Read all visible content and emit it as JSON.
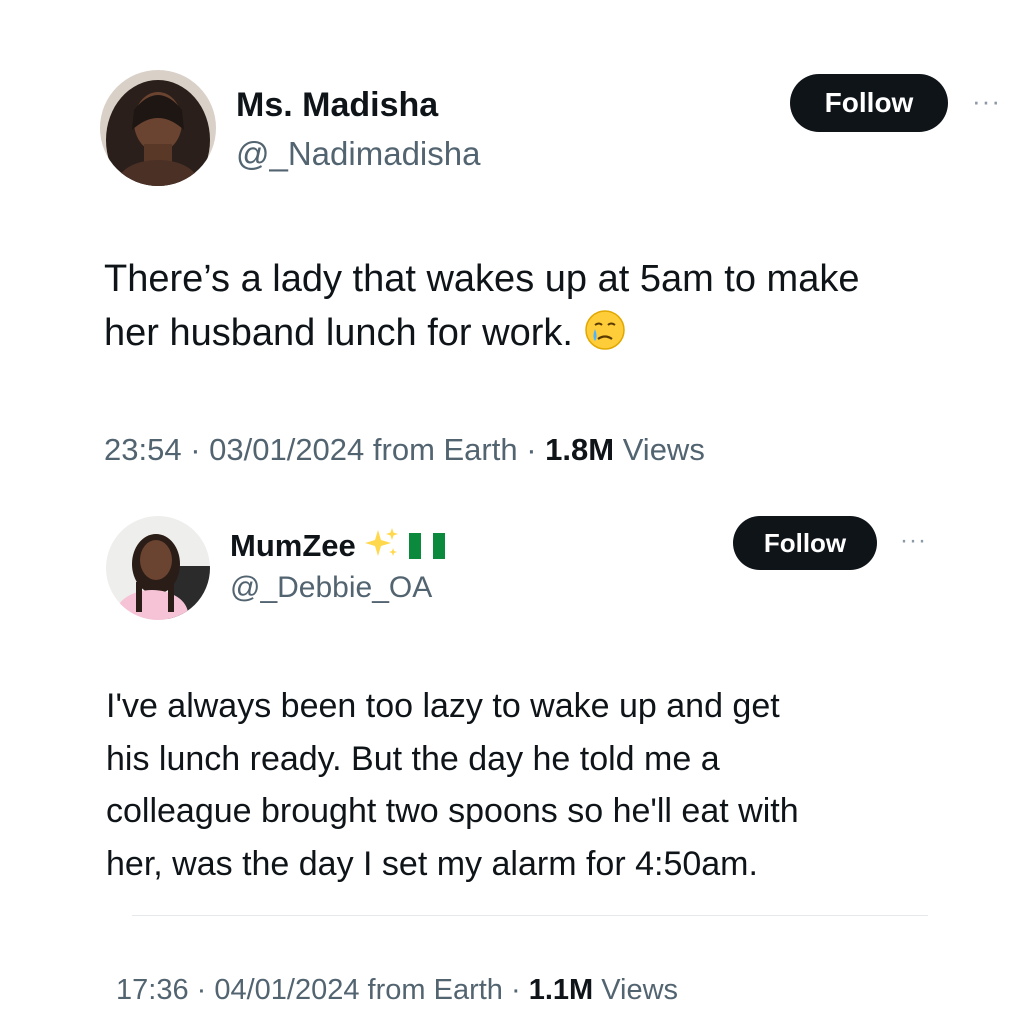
{
  "tweet1": {
    "display_name": "Ms. Madisha",
    "handle": "@_Nadimadisha",
    "follow_label": "Follow",
    "more_label": "···",
    "text_line1": "There’s a lady that wakes up at 5am to make",
    "text_line2": "her husband lunch for work.",
    "emoji": "crying-face-emoji",
    "meta_time": "23:54 · 03/01/2024 from Earth · ",
    "views_count": "1.8M",
    "views_label": " Views"
  },
  "tweet2": {
    "display_name": "MumZee",
    "name_icons": [
      "sparkles-icon",
      "nigeria-flag-icon"
    ],
    "handle": "@_Debbie_OA",
    "follow_label": "Follow",
    "more_label": "···",
    "text_line1": "I've always been too lazy to wake up and get",
    "text_line2": "his lunch ready. But the day he told me a",
    "text_line3": "colleague brought two spoons so he'll eat with",
    "text_line4": "her, was the day I set my alarm for 4:50am.",
    "meta_time": "17:36 · 04/01/2024 from Earth · ",
    "views_count": "1.1M",
    "views_label": " Views"
  },
  "colors": {
    "button_bg": "#0f1419",
    "text_primary": "#0f1419",
    "text_secondary": "#536471",
    "divider": "#e6e9eb"
  }
}
